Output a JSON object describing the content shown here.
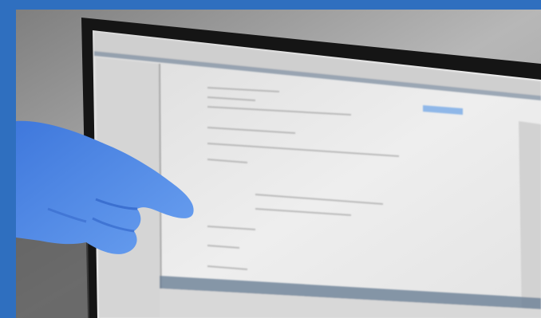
{
  "photo": {
    "subject": "gloved-hand-pointing-at-monitor",
    "frame_color": "#2f6fbf",
    "glove_color": "#4b86e6",
    "monitor_bezel_color": "#151515",
    "screen_color": "#e9e9e9",
    "blur": "heavy"
  }
}
